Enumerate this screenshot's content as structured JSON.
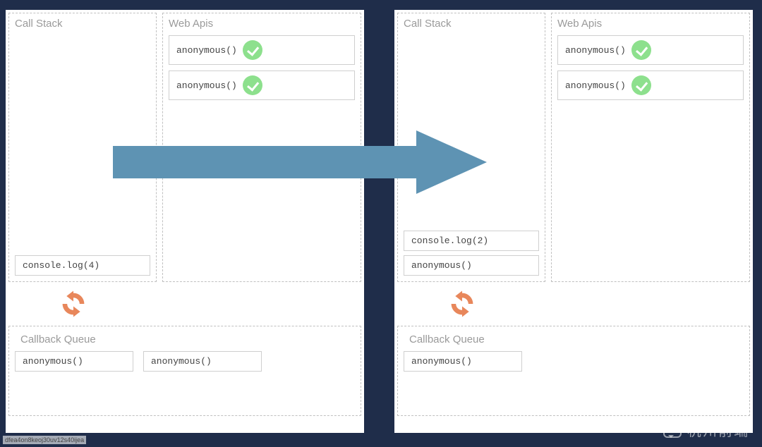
{
  "labels": {
    "callstack": "Call Stack",
    "webapis": "Web Apis",
    "callback": "Callback Queue"
  },
  "left": {
    "callstack_items": [
      "console.log(4)"
    ],
    "webapi_items": [
      "anonymous()",
      "anonymous()"
    ],
    "callback_items": [
      "anonymous()",
      "anonymous()"
    ]
  },
  "right": {
    "callstack_items": [
      "console.log(2)",
      "anonymous()"
    ],
    "webapi_items": [
      "anonymous()",
      "anonymous()"
    ],
    "callback_items": [
      "anonymous()"
    ]
  },
  "watermark": "杭州前端",
  "tiny_text": "dfea4on8keoj30uv12s40ijea"
}
